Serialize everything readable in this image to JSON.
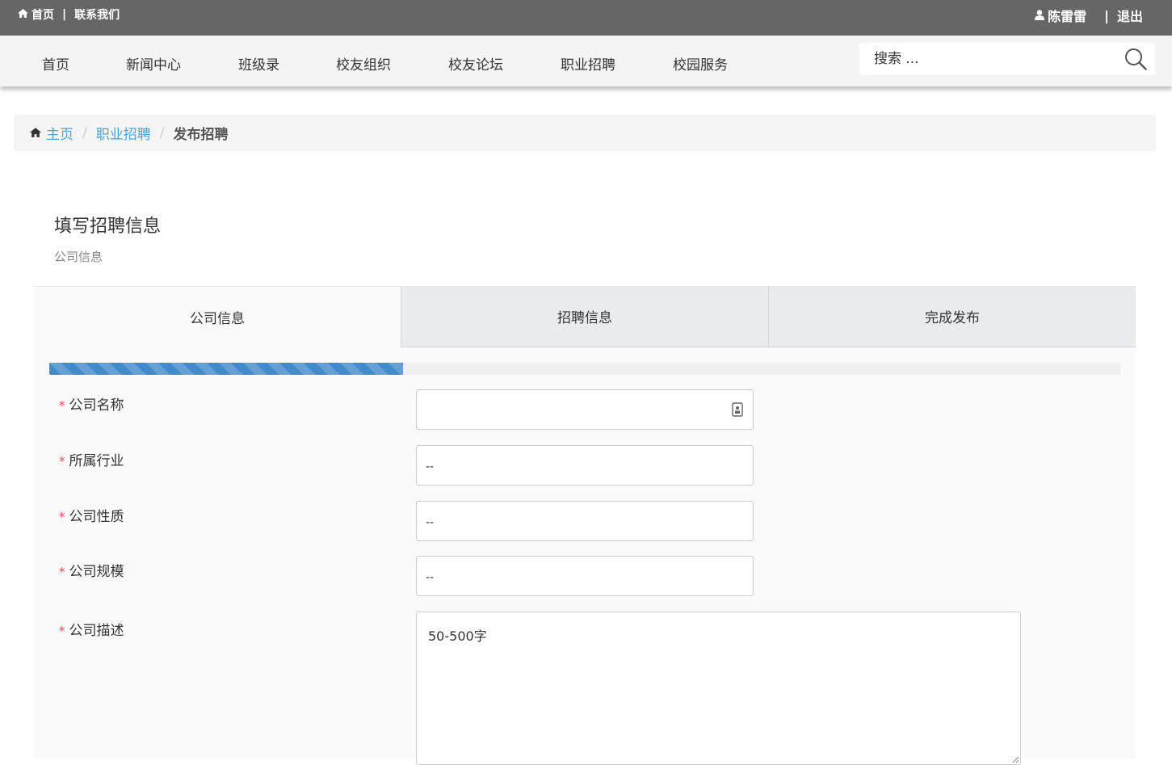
{
  "topbar": {
    "home_label": "首页",
    "contact_label": "联系我们",
    "user_name": "陈雷雷",
    "logout_label": "退出"
  },
  "nav": {
    "items": [
      "首页",
      "新闻中心",
      "班级录",
      "校友组织",
      "校友论坛",
      "职业招聘",
      "校园服务"
    ],
    "search_placeholder": "搜索 ..."
  },
  "breadcrumb": {
    "home": "主页",
    "section": "职业招聘",
    "current": "发布招聘"
  },
  "form": {
    "title": "填写招聘信息",
    "subtitle": "公司信息",
    "tabs": [
      "公司信息",
      "招聘信息",
      "完成发布"
    ],
    "active_tab": 0,
    "progress_percent": 33,
    "fields": {
      "company_name": {
        "label": "公司名称",
        "value": ""
      },
      "industry": {
        "label": "所属行业",
        "value": "--"
      },
      "nature": {
        "label": "公司性质",
        "value": "--"
      },
      "scale": {
        "label": "公司规模",
        "value": "--"
      },
      "description": {
        "label": "公司描述",
        "placeholder": "50-500字"
      }
    }
  },
  "colors": {
    "topbar_bg": "#666666",
    "link": "#4aa3df",
    "progress": "#428bca",
    "required": "#d9534f"
  }
}
